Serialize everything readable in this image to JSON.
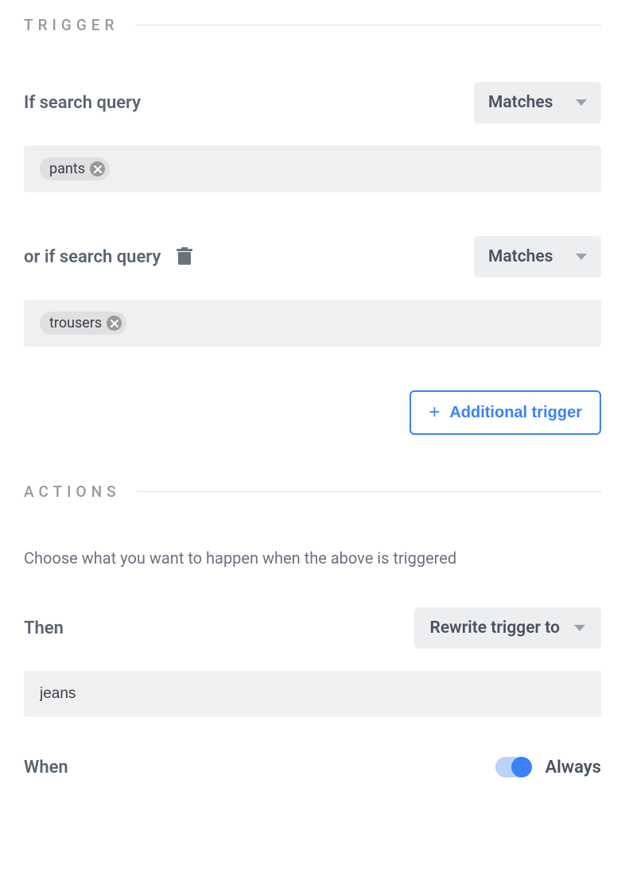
{
  "sections": {
    "trigger_title": "TRIGGER",
    "actions_title": "ACTIONS"
  },
  "triggers": [
    {
      "label": "If search query",
      "deletable": false,
      "match_type": "Matches",
      "tags": [
        "pants"
      ]
    },
    {
      "label": "or if search query",
      "deletable": true,
      "match_type": "Matches",
      "tags": [
        "trousers"
      ]
    }
  ],
  "add_trigger_label": "Additional trigger",
  "actions": {
    "description": "Choose what you want to happen when the above is triggered",
    "then_label": "Then",
    "then_action": "Rewrite trigger to",
    "value": "jeans",
    "when_label": "When",
    "when_toggle_on": true,
    "when_toggle_label": "Always"
  }
}
